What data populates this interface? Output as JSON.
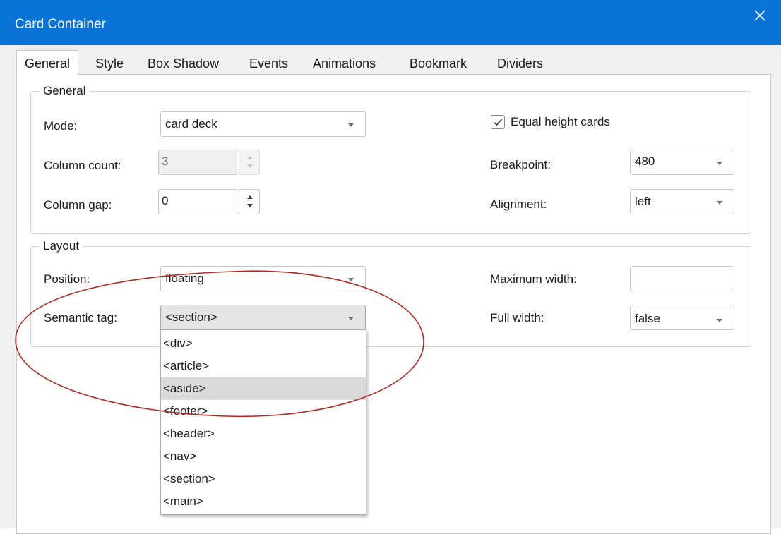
{
  "window": {
    "title": "Card Container",
    "accent": "#0a74d6"
  },
  "tabs": [
    {
      "label": "General",
      "active": true
    },
    {
      "label": "Style"
    },
    {
      "label": "Box Shadow"
    },
    {
      "label": "Events"
    },
    {
      "label": "Animations"
    },
    {
      "label": "Bookmark"
    },
    {
      "label": "Dividers"
    }
  ],
  "general": {
    "legend": "General",
    "mode_label": "Mode:",
    "mode_value": "card deck",
    "column_count_label": "Column count:",
    "column_count_value": "3",
    "column_gap_label": "Column gap:",
    "column_gap_value": "0",
    "equal_height_label": "Equal height cards",
    "equal_height_checked": true,
    "breakpoint_label": "Breakpoint:",
    "breakpoint_value": "480",
    "alignment_label": "Alignment:",
    "alignment_value": "left"
  },
  "layout": {
    "legend": "Layout",
    "position_label": "Position:",
    "position_value": "floating",
    "semantic_tag_label": "Semantic tag:",
    "semantic_tag_value": "<section>",
    "max_width_label": "Maximum width:",
    "max_width_value": "",
    "full_width_label": "Full width:",
    "full_width_value": "false"
  },
  "semantic_tag_options": [
    "<div>",
    "<article>",
    "<aside>",
    "<footer>",
    "<header>",
    "<nav>",
    "<section>",
    "<main>"
  ],
  "semantic_tag_highlighted": "<aside>",
  "annotation_color": "#b02a22"
}
